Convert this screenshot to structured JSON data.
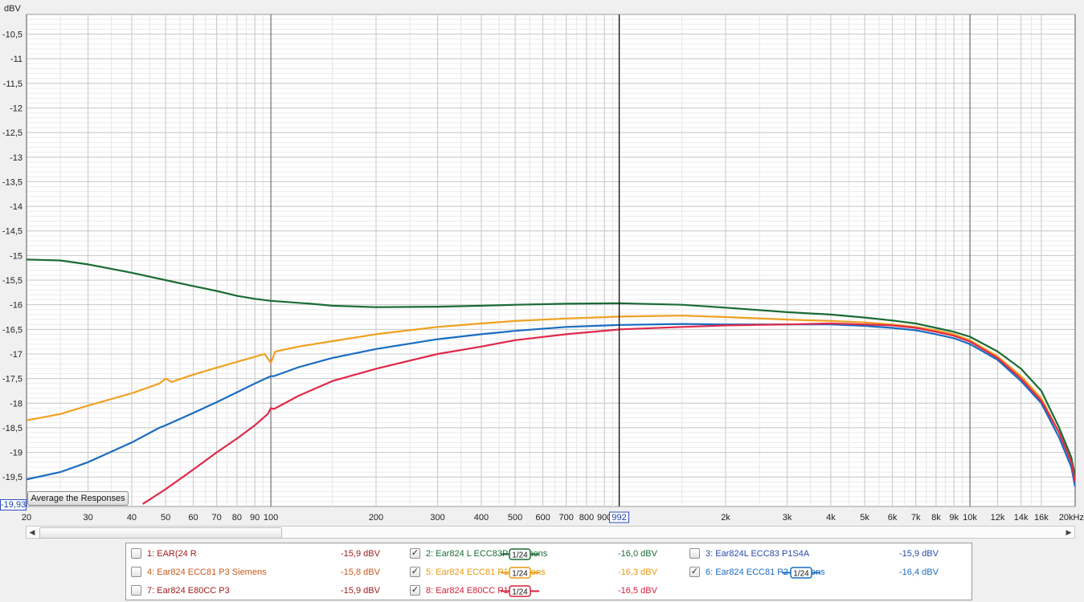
{
  "chart_data": {
    "type": "line",
    "title": "",
    "xlabel": "",
    "ylabel": "dBV",
    "x_scale": "log",
    "xlim": [
      20,
      20000
    ],
    "ylim": [
      -20.1,
      -10.1
    ],
    "x_ticks": [
      {
        "v": 20,
        "label": "20",
        "major": true
      },
      {
        "v": 30,
        "label": "30",
        "major": false
      },
      {
        "v": 40,
        "label": "40",
        "major": false
      },
      {
        "v": 50,
        "label": "50",
        "major": false
      },
      {
        "v": 60,
        "label": "60",
        "major": false
      },
      {
        "v": 70,
        "label": "70",
        "major": false
      },
      {
        "v": 80,
        "label": "80",
        "major": false
      },
      {
        "v": 90,
        "label": "90",
        "major": false
      },
      {
        "v": 100,
        "label": "100",
        "major": true
      },
      {
        "v": 200,
        "label": "200",
        "major": false
      },
      {
        "v": 300,
        "label": "300",
        "major": false
      },
      {
        "v": 400,
        "label": "400",
        "major": false
      },
      {
        "v": 500,
        "label": "500",
        "major": false
      },
      {
        "v": 600,
        "label": "600",
        "major": false
      },
      {
        "v": 700,
        "label": "700",
        "major": false
      },
      {
        "v": 800,
        "label": "800",
        "major": false
      },
      {
        "v": 900,
        "label": "900",
        "major": false
      },
      {
        "v": 2000,
        "label": "2k",
        "major": false
      },
      {
        "v": 3000,
        "label": "3k",
        "major": false
      },
      {
        "v": 4000,
        "label": "4k",
        "major": false
      },
      {
        "v": 5000,
        "label": "5k",
        "major": false
      },
      {
        "v": 6000,
        "label": "6k",
        "major": false
      },
      {
        "v": 7000,
        "label": "7k",
        "major": false
      },
      {
        "v": 8000,
        "label": "8k",
        "major": false
      },
      {
        "v": 9000,
        "label": "9k",
        "major": false
      },
      {
        "v": 10000,
        "label": "10k",
        "major": true
      },
      {
        "v": 12000,
        "label": "12k",
        "major": false
      },
      {
        "v": 14000,
        "label": "14k",
        "major": false
      },
      {
        "v": 16000,
        "label": "16k",
        "major": false
      },
      {
        "v": 20000,
        "label": "20kHz",
        "major": true
      }
    ],
    "y_ticks": [
      {
        "v": -10.5,
        "label": "-10,5"
      },
      {
        "v": -11,
        "label": "-11"
      },
      {
        "v": -11.5,
        "label": "-11,5"
      },
      {
        "v": -12,
        "label": "-12"
      },
      {
        "v": -12.5,
        "label": "-12,5"
      },
      {
        "v": -13,
        "label": "-13"
      },
      {
        "v": -13.5,
        "label": "-13,5"
      },
      {
        "v": -14,
        "label": "-14"
      },
      {
        "v": -14.5,
        "label": "-14,5"
      },
      {
        "v": -15,
        "label": "-15"
      },
      {
        "v": -15.5,
        "label": "-15,5"
      },
      {
        "v": -16,
        "label": "-16"
      },
      {
        "v": -16.5,
        "label": "-16,5"
      },
      {
        "v": -17,
        "label": "-17"
      },
      {
        "v": -17.5,
        "label": "-17,5"
      },
      {
        "v": -18,
        "label": "-18"
      },
      {
        "v": -18.5,
        "label": "-18,5"
      },
      {
        "v": -19,
        "label": "-19"
      },
      {
        "v": -19.5,
        "label": "-19,5"
      }
    ],
    "grid": true,
    "cursor": {
      "x": 992,
      "label": "992",
      "y_readout": "-19,93"
    },
    "series": [
      {
        "name": "2: Ear824 L ECC83P1Siemens",
        "color": "#1a6b35",
        "points": [
          [
            20,
            -15.08
          ],
          [
            25,
            -15.1
          ],
          [
            30,
            -15.18
          ],
          [
            40,
            -15.35
          ],
          [
            50,
            -15.5
          ],
          [
            60,
            -15.62
          ],
          [
            70,
            -15.72
          ],
          [
            80,
            -15.82
          ],
          [
            90,
            -15.88
          ],
          [
            100,
            -15.92
          ],
          [
            130,
            -15.98
          ],
          [
            150,
            -16.02
          ],
          [
            200,
            -16.05
          ],
          [
            300,
            -16.04
          ],
          [
            400,
            -16.02
          ],
          [
            500,
            -16.0
          ],
          [
            700,
            -15.98
          ],
          [
            1000,
            -15.97
          ],
          [
            1500,
            -16.0
          ],
          [
            2000,
            -16.06
          ],
          [
            3000,
            -16.15
          ],
          [
            4000,
            -16.2
          ],
          [
            5000,
            -16.26
          ],
          [
            6000,
            -16.32
          ],
          [
            7000,
            -16.38
          ],
          [
            8000,
            -16.47
          ],
          [
            9000,
            -16.55
          ],
          [
            10000,
            -16.65
          ],
          [
            12000,
            -16.95
          ],
          [
            14000,
            -17.3
          ],
          [
            16000,
            -17.75
          ],
          [
            18000,
            -18.5
          ],
          [
            19500,
            -19.1
          ],
          [
            20000,
            -19.5
          ]
        ]
      },
      {
        "name": "5: Ear824 ECC81 P1 Siemens",
        "color": "#f0a020",
        "points": [
          [
            20,
            -18.35
          ],
          [
            25,
            -18.22
          ],
          [
            30,
            -18.05
          ],
          [
            40,
            -17.8
          ],
          [
            48,
            -17.6
          ],
          [
            50,
            -17.5
          ],
          [
            52,
            -17.57
          ],
          [
            60,
            -17.42
          ],
          [
            70,
            -17.28
          ],
          [
            80,
            -17.16
          ],
          [
            90,
            -17.06
          ],
          [
            96,
            -17.0
          ],
          [
            100,
            -17.18
          ],
          [
            103,
            -16.95
          ],
          [
            120,
            -16.85
          ],
          [
            150,
            -16.74
          ],
          [
            200,
            -16.6
          ],
          [
            300,
            -16.45
          ],
          [
            400,
            -16.38
          ],
          [
            500,
            -16.33
          ],
          [
            700,
            -16.28
          ],
          [
            1000,
            -16.24
          ],
          [
            1500,
            -16.22
          ],
          [
            2000,
            -16.25
          ],
          [
            3000,
            -16.3
          ],
          [
            4000,
            -16.33
          ],
          [
            5000,
            -16.36
          ],
          [
            6000,
            -16.4
          ],
          [
            7000,
            -16.45
          ],
          [
            8000,
            -16.52
          ],
          [
            9000,
            -16.6
          ],
          [
            10000,
            -16.72
          ],
          [
            12000,
            -17.05
          ],
          [
            14000,
            -17.45
          ],
          [
            16000,
            -17.9
          ],
          [
            18000,
            -18.6
          ],
          [
            19500,
            -19.2
          ],
          [
            20000,
            -19.6
          ]
        ]
      },
      {
        "name": "6: Ear824 ECC81 P2 Siemens",
        "color": "#1a6cc0",
        "points": [
          [
            20,
            -19.55
          ],
          [
            25,
            -19.4
          ],
          [
            30,
            -19.2
          ],
          [
            40,
            -18.8
          ],
          [
            48,
            -18.5
          ],
          [
            50,
            -18.45
          ],
          [
            60,
            -18.2
          ],
          [
            70,
            -17.98
          ],
          [
            80,
            -17.78
          ],
          [
            90,
            -17.6
          ],
          [
            98,
            -17.48
          ],
          [
            100,
            -17.45
          ],
          [
            102,
            -17.45
          ],
          [
            120,
            -17.27
          ],
          [
            150,
            -17.08
          ],
          [
            200,
            -16.9
          ],
          [
            300,
            -16.7
          ],
          [
            400,
            -16.6
          ],
          [
            500,
            -16.53
          ],
          [
            700,
            -16.45
          ],
          [
            1000,
            -16.41
          ],
          [
            1500,
            -16.39
          ],
          [
            2000,
            -16.4
          ],
          [
            3000,
            -16.4
          ],
          [
            4000,
            -16.4
          ],
          [
            5000,
            -16.43
          ],
          [
            6000,
            -16.47
          ],
          [
            7000,
            -16.52
          ],
          [
            8000,
            -16.6
          ],
          [
            9000,
            -16.68
          ],
          [
            10000,
            -16.8
          ],
          [
            12000,
            -17.12
          ],
          [
            14000,
            -17.55
          ],
          [
            16000,
            -18.0
          ],
          [
            18000,
            -18.7
          ],
          [
            19500,
            -19.3
          ],
          [
            20000,
            -19.7
          ]
        ]
      },
      {
        "name": "8: Ear824 E80CC P1",
        "color": "#e0284a",
        "points": [
          [
            43,
            -20.05
          ],
          [
            50,
            -19.75
          ],
          [
            60,
            -19.35
          ],
          [
            70,
            -19.0
          ],
          [
            80,
            -18.72
          ],
          [
            90,
            -18.45
          ],
          [
            98,
            -18.22
          ],
          [
            100,
            -18.1
          ],
          [
            102,
            -18.12
          ],
          [
            120,
            -17.85
          ],
          [
            150,
            -17.55
          ],
          [
            200,
            -17.3
          ],
          [
            300,
            -17.0
          ],
          [
            400,
            -16.85
          ],
          [
            500,
            -16.72
          ],
          [
            700,
            -16.6
          ],
          [
            1000,
            -16.5
          ],
          [
            1500,
            -16.45
          ],
          [
            2000,
            -16.42
          ],
          [
            3000,
            -16.4
          ],
          [
            4000,
            -16.38
          ],
          [
            5000,
            -16.4
          ],
          [
            6000,
            -16.42
          ],
          [
            7000,
            -16.47
          ],
          [
            8000,
            -16.55
          ],
          [
            9000,
            -16.63
          ],
          [
            10000,
            -16.75
          ],
          [
            12000,
            -17.08
          ],
          [
            14000,
            -17.5
          ],
          [
            16000,
            -17.95
          ],
          [
            18000,
            -18.6
          ],
          [
            19500,
            -19.2
          ],
          [
            20000,
            -19.6
          ]
        ]
      }
    ]
  },
  "ui": {
    "avg_button": "Average the Responses",
    "smoothing_label": "1/24"
  },
  "legend": [
    {
      "name": "1: EAR(24 R",
      "value": "-15,9 dBV",
      "checked": false,
      "color": "#a01c1c",
      "smoothing": false
    },
    {
      "name": "2: Ear824 L ECC83P1Siemens",
      "value": "-16,0 dBV",
      "checked": true,
      "color": "#1a6b35",
      "smoothing": true
    },
    {
      "name": "3: Ear824L ECC83 P1S4A",
      "value": "-15,9 dBV",
      "checked": false,
      "color": "#2a4aa8",
      "smoothing": false
    },
    {
      "name": "4: Ear824 ECC81 P3 Siemens",
      "value": "-15,8 dBV",
      "checked": false,
      "color": "#c85a1a",
      "smoothing": false
    },
    {
      "name": "5: Ear824 ECC81 P1 Siemens",
      "value": "-16,3 dBV",
      "checked": true,
      "color": "#e89a10",
      "smoothing": true
    },
    {
      "name": "6: Ear824 ECC81 P2 Siemens",
      "value": "-16,4 dBV",
      "checked": true,
      "color": "#1a6cc0",
      "smoothing": true
    },
    {
      "name": "7: Ear824 E80CC P3",
      "value": "-15,9 dBV",
      "checked": false,
      "color": "#a01c1c",
      "smoothing": false
    },
    {
      "name": "8: Ear824 E80CC P1",
      "value": "-16,5 dBV",
      "checked": true,
      "color": "#d4203c",
      "smoothing": true
    }
  ]
}
